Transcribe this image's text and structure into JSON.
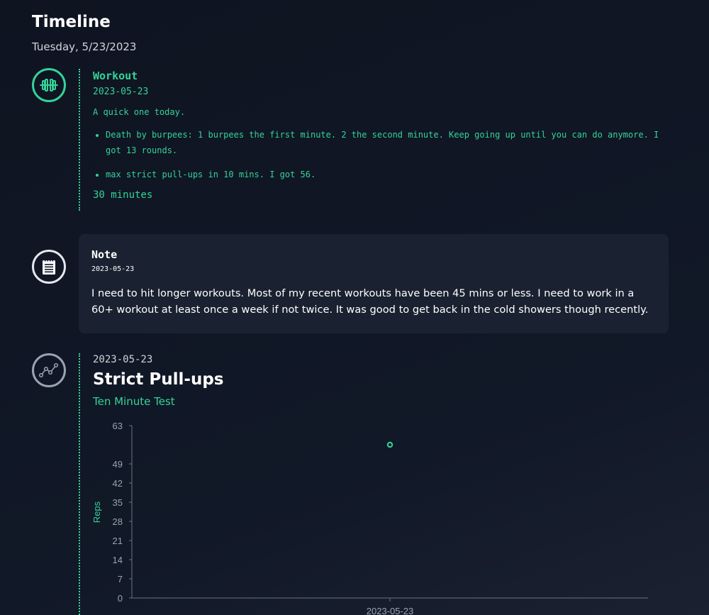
{
  "page": {
    "title": "Timeline",
    "date": "Tuesday, 5/23/2023"
  },
  "workout": {
    "icon": "dumbbell-icon",
    "title": "Workout",
    "date": "2023-05-23",
    "intro": "A quick one today.",
    "items": [
      "Death by burpees: 1 burpees the first minute. 2 the second minute. Keep going up until you can do anymore. I got 13 rounds.",
      "max strict pull-ups in 10 mins. I got 56."
    ],
    "duration": "30 minutes",
    "accent": "#34d399"
  },
  "note": {
    "icon": "notepad-icon",
    "title": "Note",
    "date": "2023-05-23",
    "body": "I need to hit longer workouts. Most of my recent workouts have been 45 mins or less. I need to work in a 60+ workout at least once a week if not twice. It was good to get back in the cold showers though recently."
  },
  "metric": {
    "icon": "line-chart-icon",
    "date": "2023-05-23",
    "title": "Strict Pull-ups",
    "subtitle": "Ten Minute Test"
  },
  "chart_data": {
    "type": "scatter",
    "x": [
      "2023-05-23"
    ],
    "values": [
      56
    ],
    "ylabel": "Reps",
    "yticks": [
      0,
      7,
      14,
      21,
      28,
      35,
      42,
      49,
      63
    ],
    "ylim": [
      0,
      63
    ],
    "grid": false,
    "point_color": "#34d399"
  }
}
